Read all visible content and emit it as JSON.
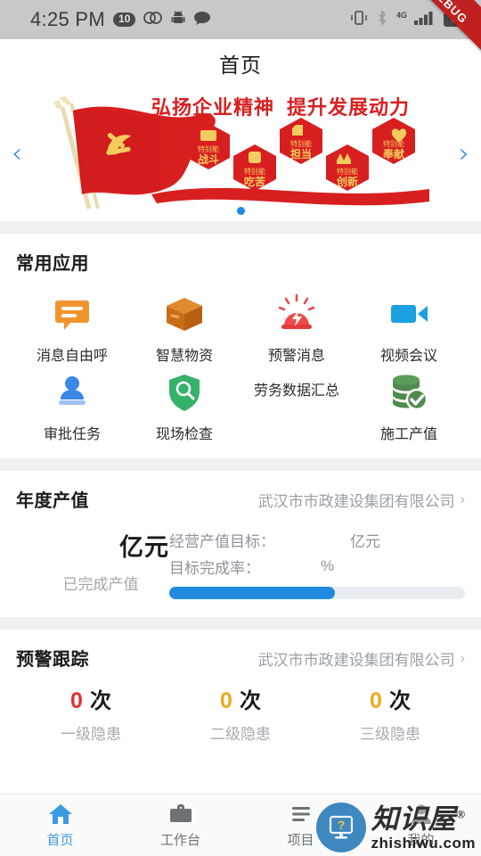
{
  "statusbar": {
    "time": "4:25 PM",
    "notification_badge": "10",
    "icons": [
      "loop-icon",
      "android-robot-icon",
      "chat-bubble-icon",
      "vibrate-icon",
      "bluetooth-icon",
      "signal-bars-icon"
    ],
    "network_label": "4G",
    "battery_level": "58",
    "debug_ribbon": "DEBUG"
  },
  "header": {
    "title": "首页"
  },
  "banner": {
    "slogan_left": "弘扬企业精神",
    "slogan_right": "提升发展动力",
    "hexagons": [
      {
        "top": "特别能",
        "bottom": "战斗",
        "icon": "fist-banner-icon"
      },
      {
        "top": "特别能",
        "bottom": "吃苦",
        "icon": "raised-fist-icon"
      },
      {
        "top": "特别能",
        "bottom": "担当",
        "icon": "thumbs-up-icon"
      },
      {
        "top": "特别能",
        "bottom": "创新",
        "icon": "crown-icon"
      },
      {
        "top": "特别能",
        "bottom": "奉献",
        "icon": "heart-hand-icon"
      }
    ],
    "prev_arrow": "‹",
    "next_arrow": "›",
    "dot_count": 1
  },
  "apps": {
    "title": "常用应用",
    "items": [
      {
        "label": "消息自由呼",
        "icon": "chat-bubble-icon",
        "color": "#F0942F"
      },
      {
        "label": "智慧物资",
        "icon": "package-box-icon",
        "color": "#D9751C"
      },
      {
        "label": "预警消息",
        "icon": "alarm-light-icon",
        "color": "#EE4B4B"
      },
      {
        "label": "视频会议",
        "icon": "video-camera-icon",
        "color": "#1BA1E2"
      },
      {
        "label": "审批任务",
        "icon": "approval-stamp-icon",
        "color": "#3B87E8"
      },
      {
        "label": "现场检查",
        "icon": "shield-search-icon",
        "color": "#35B26A"
      },
      {
        "label": "劳务数据汇总",
        "icon": "none",
        "color": "#2b2b2b"
      },
      {
        "label": "施工产值",
        "icon": "database-check-icon",
        "color": "#4E8B4E"
      }
    ]
  },
  "annual_output": {
    "title": "年度产值",
    "org": "武汉市市政建设集团有限公司",
    "chevron": "›",
    "value": "",
    "value_unit": "亿元",
    "value_caption": "已完成产值",
    "target_label": "经营产值目标：",
    "target_value": "",
    "target_unit": "亿元",
    "rate_label": "目标完成率：",
    "rate_value": "",
    "rate_unit": "%",
    "progress_percent": 56,
    "progress_color": "#1f8ae0"
  },
  "warning_tracking": {
    "title": "预警跟踪",
    "org": "武汉市市政建设集团有限公司",
    "chevron": "›",
    "items": [
      {
        "count": "0",
        "unit": "次",
        "label": "一级隐患",
        "color": "#E03030"
      },
      {
        "count": "0",
        "unit": "次",
        "label": "二级隐患",
        "color": "#F0A81E"
      },
      {
        "count": "0",
        "unit": "次",
        "label": "三级隐患",
        "color": "#F0A81E"
      }
    ]
  },
  "tabbar": {
    "items": [
      {
        "label": "首页",
        "icon": "home-icon",
        "active": true
      },
      {
        "label": "工作台",
        "icon": "briefcase-icon",
        "active": false
      },
      {
        "label": "项目",
        "icon": "list-lines-icon",
        "active": false
      },
      {
        "label": "我的",
        "icon": "user-icon",
        "active": false
      }
    ]
  },
  "watermark": {
    "cn": "知识屋",
    "registered": "®",
    "url": "zhishiwu.com",
    "icon": "monitor-question-icon",
    "color": "#3f87bf"
  }
}
